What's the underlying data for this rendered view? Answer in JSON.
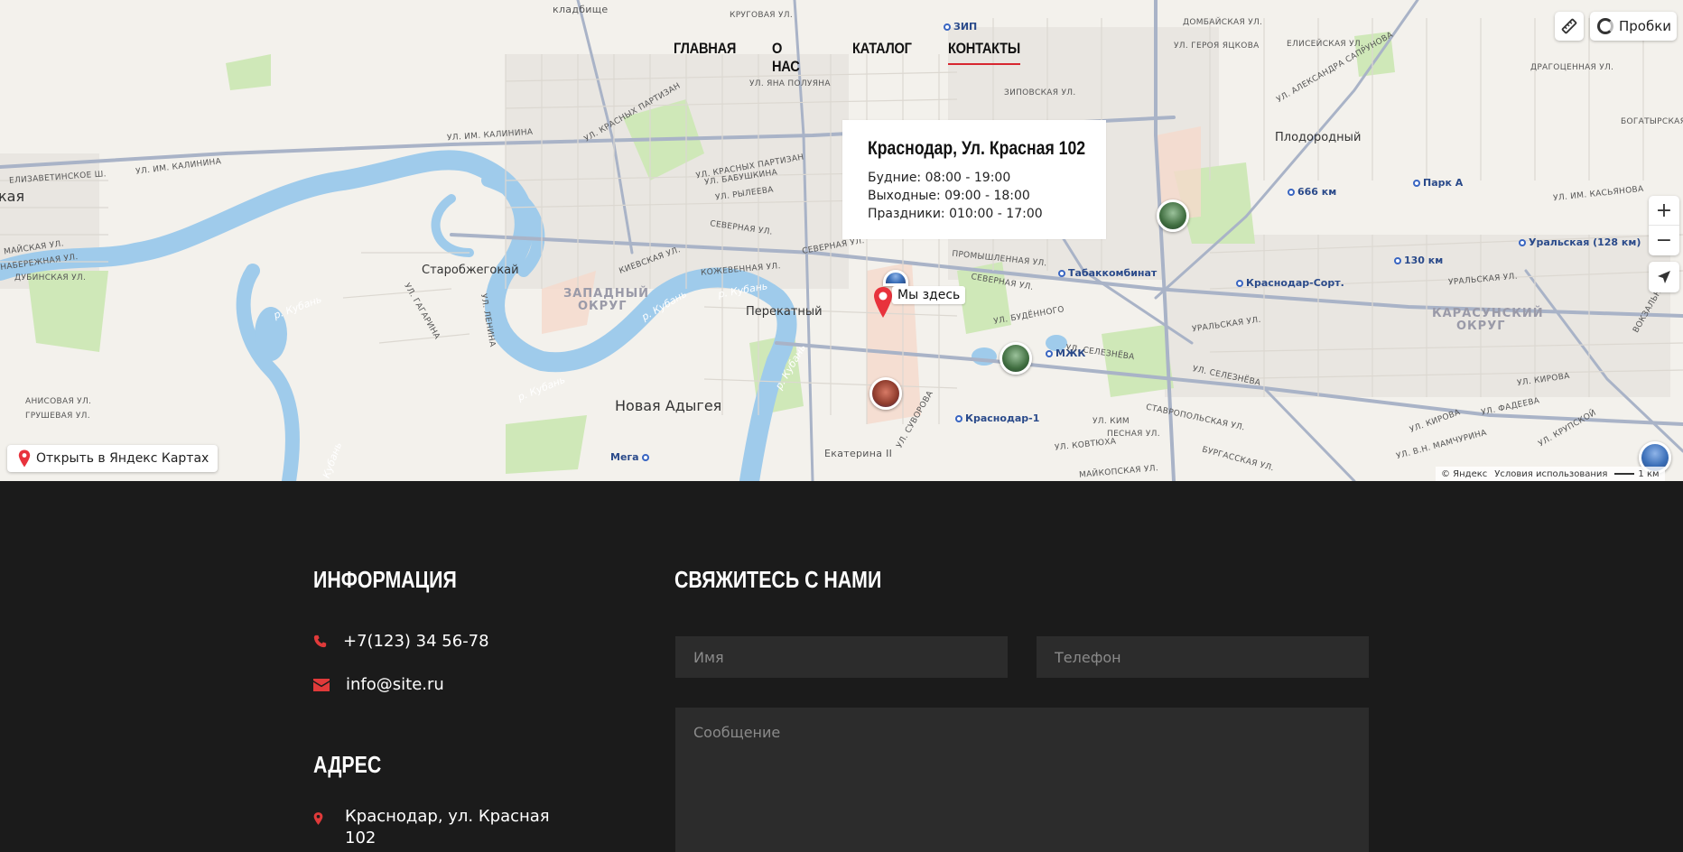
{
  "nav": {
    "items": [
      {
        "label": "ГЛАВНАЯ",
        "active": false
      },
      {
        "label": "О НАС",
        "active": false
      },
      {
        "label": "КАТАЛОГ",
        "active": false
      },
      {
        "label": "КОНТАКТЫ",
        "active": true
      }
    ],
    "active_color": "#d8262f"
  },
  "map": {
    "card": {
      "title": "Краснодар, Ул. Красная 102",
      "lines": [
        "Будние: 08:00 - 19:00",
        "Выходные: 09:00 - 18:00",
        "Праздники: 010:00 - 17:00"
      ]
    },
    "placemark_label": "Мы здесь",
    "traffic_label": "Пробки",
    "zoom_in": "+",
    "zoom_out": "−",
    "open_in_yandex": "Открыть в Яндекс Картах",
    "copyright": "© Яндекс",
    "terms": "Условия использования",
    "scale": "1 км",
    "labels": {
      "places": {
        "starokorsunskaya": "Старобжегокай",
        "novaya_adygeya": "Новая Адыгея",
        "perekatny": "Перекатный",
        "plodorodny": "Плодородный",
        "kaya": "кая",
        "ekaterina": "Екатерина II"
      },
      "districts": {
        "zapadny_1": "ЗАПАДНЫЙ",
        "zapadny_2": "ОКРУГ",
        "karasunsky_1": "КАРАСУНСКИЙ",
        "karasunsky_2": "ОКРУГ"
      },
      "rivers": {
        "kuban_1": "р. Кубань",
        "kuban_2": "р. Кубань",
        "kuban_3": "р. Кубань",
        "kuban_4": "р. Кубань",
        "kuban_5": "р. Кубань",
        "kuban_6": "р. Кубань"
      },
      "poi": {
        "zip": "ЗИП",
        "km666": "666 км",
        "park_a": "Парк А",
        "uralskaya": "Уральская (128 км)",
        "km130": "130 км",
        "tabak": "Табаккомбинат",
        "sort": "Краснодар-Сорт.",
        "mzhk": "МЖК",
        "krd1": "Краснодар-1",
        "mega": "Мега"
      },
      "streets": {
        "kalinina_1": "УЛ. ИМ. КАЛИНИНА",
        "kalinina_2": "УЛ. ИМ. КАЛИНИНА",
        "elizavetinskoe": "ЕЛИЗАВЕТИНСКОЕ Ш.",
        "krasnykh_partizan_1": "УЛ. КРАСНЫХ ПАРТИЗАН",
        "krasnykh_partizan_2": "УЛ. КРАСНЫХ ПАРТИЗАН",
        "severnaya_1": "СЕВЕРНАЯ УЛ.",
        "severnaya_2": "СЕВЕРНАЯ УЛ.",
        "severnaya_3": "СЕВЕРНАЯ УЛ.",
        "uralskaya_1": "УРАЛЬСКАЯ УЛ.",
        "uralskaya_2": "УРАЛЬСКАЯ УЛ.",
        "stavropolskaya": "СТАВРОПОЛЬСКАЯ УЛ.",
        "selezneva_1": "УЛ. СЕЛЕЗНЁВА",
        "selezneva_2": "УЛ. СЕЛЕЗНЁВА",
        "kirova_1": "УЛ. КИРОВА",
        "kirova_2": "УЛ. КИРОВА",
        "budennogo": "УЛ. БУДЁННОГО",
        "promyshlennaya": "ПРОМЫШЛЕННАЯ УЛ.",
        "kozhevennaya": "КОЖЕВЕННАЯ УЛ.",
        "kievskaya": "КИЕВСКАЯ УЛ.",
        "gagarina": "УЛ. ГАГАРИНА",
        "lenina": "УЛ. ЛЕНИНА",
        "vokzalnaya": "ВОКЗАЛЬНАЯ УЛ.",
        "yana_poluyana": "УЛ. ЯНА ПОЛУЯНА",
        "babushkina": "УЛ. БАБУШКИНА",
        "ryleeva": "УЛ. РЫЛЕЕВА",
        "geroya_yackova": "УЛ. ГЕРОЯ ЯЦКОВА",
        "aleksandra_saprunova": "УЛ. АЛЕКСАНДРА САПРУНОВА",
        "dragocennaya": "ДРАГОЦЕННАЯ УЛ.",
        "elisejskaya": "ЕЛИСЕЙСКАЯ УЛ.",
        "domba": "ДОМБАЙСКАЯ УЛ.",
        "kasyanova": "УЛ. ИМ. КАСЬЯНОВА",
        "kruglova": "КРУГОВАЯ УЛ.",
        "kladbishe": "кладбище",
        "zipovskaya": "ЗИПОВСКАЯ УЛ.",
        "bogatyrskaya": "БОГАТЫРСКАЯ",
        "kovtyukha": "УЛ. КОВТЮХА",
        "pesnaya": "ПЕСНАЯ УЛ.",
        "kima": "УЛ. КИМ",
        "burgasskaya": "БУРГАССКАЯ УЛ.",
        "maykopskaya": "МАЙКОПСКАЯ УЛ.",
        "mamchurina": "УЛ. В.Н. МАМЧУРИНА",
        "anisovaya": "АНИСОВАЯ УЛ.",
        "grushevaya": "ГРУШЕВАЯ УЛ.",
        "naberezhnaya": "НАБЕРЕЖНАЯ УЛ.",
        "dubinskaya": "ДУБИНСКАЯ УЛ.",
        "mayskaya": "МАЙСКАЯ УЛ.",
        "suvorova": "УЛ. СУВОРОВА",
        "fadeeva": "УЛ. ФАДЕЕВА",
        "kruskaya": "УЛ. КРУПСКОЙ"
      }
    }
  },
  "footer": {
    "info_heading": "ИНФОРМАЦИЯ",
    "phone": "+7(123) 34 56-78",
    "email": "info@site.ru",
    "address_heading": "АДРЕС",
    "address_line1": "Краснодар, ул. Красная",
    "address_line2": "102",
    "contact_heading": "СВЯЖИТЕСЬ С НАМИ",
    "form": {
      "name_placeholder": "Имя",
      "phone_placeholder": "Телефон",
      "message_placeholder": "Сообщение"
    },
    "icon_color": "#e03a3a"
  }
}
